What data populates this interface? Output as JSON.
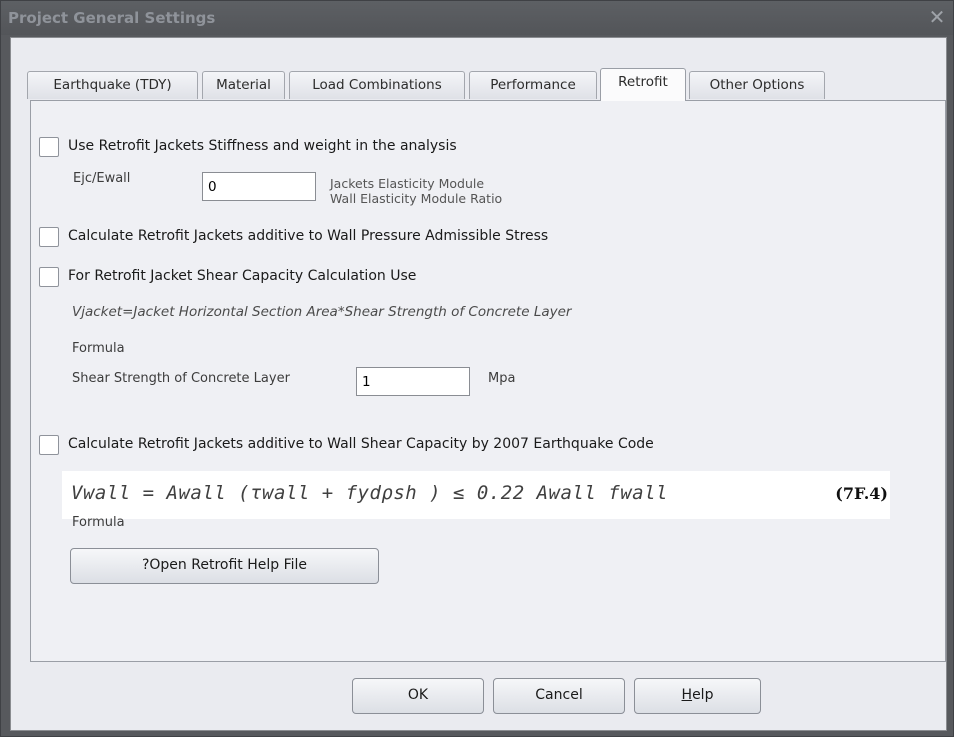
{
  "window": {
    "title": "Project General Settings",
    "close_glyph": "✕"
  },
  "tabs": [
    {
      "label": "Earthquake (TDY)"
    },
    {
      "label": "Material"
    },
    {
      "label": "Load Combinations"
    },
    {
      "label": "Performance"
    },
    {
      "label": "Retrofit",
      "active": true
    },
    {
      "label": "Other Options"
    }
  ],
  "retrofit": {
    "use_stiffness": {
      "label": "Use Retrofit Jackets Stiffness and weight in the analysis",
      "checked": false
    },
    "ejc_label": "Ejc/Ewall",
    "ejc_value": "0",
    "ejc_note_line1": "Jackets Elasticity Module",
    "ejc_note_line2": "Wall Elasticity Module Ratio",
    "pressure_stress": {
      "label": "Calculate Retrofit Jackets additive to Wall Pressure Admissible Stress",
      "checked": false
    },
    "shear_capacity": {
      "label": "For Retrofit Jacket Shear Capacity Calculation Use",
      "checked": false
    },
    "shear_formula_text": "Vjacket=Jacket Horizontal Section Area*Shear Strength of Concrete Layer",
    "shear_formula_caption": "Formula",
    "shear_strength_label": "Shear Strength of Concrete Layer",
    "shear_strength_value": "1",
    "shear_strength_unit": "Mpa",
    "earthquake_code": {
      "label": "Calculate Retrofit Jackets additive to Wall Shear Capacity by 2007 Earthquake Code",
      "checked": false
    },
    "code_formula_text": "Vwall = Awall (τwall + fydρsh ) ≤ 0.22 Awall fwall",
    "code_formula_ref": "(7F.4)",
    "code_formula_caption": "Formula",
    "help_file_button": "?Open Retrofit Help File"
  },
  "footer": {
    "ok_label": "OK",
    "cancel_label": "Cancel",
    "help_label_prefix": "",
    "help_label_mnemonic": "H",
    "help_label_rest": "elp"
  },
  "colors": {
    "titlebar": "#57595d",
    "client": "#eaebf0",
    "panel": "#eff0f4"
  },
  "icons": {
    "close": "close-icon"
  }
}
